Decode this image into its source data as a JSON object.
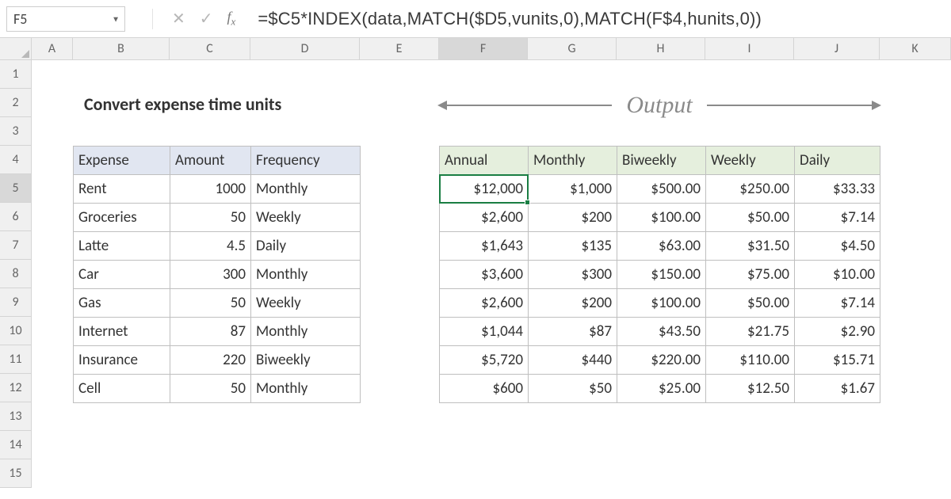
{
  "namebox": "F5",
  "formula": "=$C5*INDEX(data,MATCH($D5,vunits,0),MATCH(F$4,hunits,0))",
  "columns": [
    "A",
    "B",
    "C",
    "D",
    "E",
    "F",
    "G",
    "H",
    "I",
    "J",
    "K"
  ],
  "rows": [
    "1",
    "2",
    "3",
    "4",
    "5",
    "6",
    "7",
    "8",
    "9",
    "10",
    "11",
    "12",
    "13",
    "14",
    "15"
  ],
  "activeCol": "F",
  "activeRow": "5",
  "title": "Convert expense time units",
  "outputLabel": "Output",
  "left": {
    "headers": [
      "Expense",
      "Amount",
      "Frequency"
    ],
    "rows": [
      {
        "expense": "Rent",
        "amount": "1000",
        "freq": "Monthly"
      },
      {
        "expense": "Groceries",
        "amount": "50",
        "freq": "Weekly"
      },
      {
        "expense": "Latte",
        "amount": "4.5",
        "freq": "Daily"
      },
      {
        "expense": "Car",
        "amount": "300",
        "freq": "Monthly"
      },
      {
        "expense": "Gas",
        "amount": "50",
        "freq": "Weekly"
      },
      {
        "expense": "Internet",
        "amount": "87",
        "freq": "Monthly"
      },
      {
        "expense": "Insurance",
        "amount": "220",
        "freq": "Biweekly"
      },
      {
        "expense": "Cell",
        "amount": "50",
        "freq": "Monthly"
      }
    ]
  },
  "right": {
    "headers": [
      "Annual",
      "Monthly",
      "Biweekly",
      "Weekly",
      "Daily"
    ],
    "rows": [
      [
        "$12,000",
        "$1,000",
        "$500.00",
        "$250.00",
        "$33.33"
      ],
      [
        "$2,600",
        "$200",
        "$100.00",
        "$50.00",
        "$7.14"
      ],
      [
        "$1,643",
        "$135",
        "$63.00",
        "$31.50",
        "$4.50"
      ],
      [
        "$3,600",
        "$300",
        "$150.00",
        "$75.00",
        "$10.00"
      ],
      [
        "$2,600",
        "$200",
        "$100.00",
        "$50.00",
        "$7.14"
      ],
      [
        "$1,044",
        "$87",
        "$43.50",
        "$21.75",
        "$2.90"
      ],
      [
        "$5,720",
        "$440",
        "$220.00",
        "$110.00",
        "$15.71"
      ],
      [
        "$600",
        "$50",
        "$25.00",
        "$12.50",
        "$1.67"
      ]
    ]
  }
}
